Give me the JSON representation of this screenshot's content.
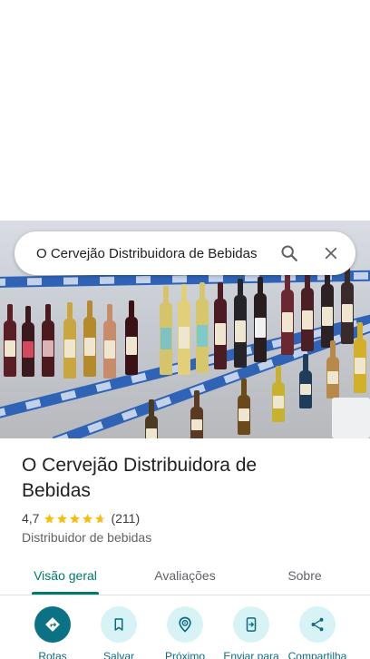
{
  "search": {
    "query": "O Cervejão Distribuidora de Bebidas"
  },
  "place": {
    "name": "O Cervejão Distribuidora de Bebidas",
    "rating": "4,7",
    "stars": 4.7,
    "review_count": "(211)",
    "category": "Distribuidor de bebidas"
  },
  "tabs": [
    "Visão geral",
    "Avaliações",
    "Sobre"
  ],
  "actions": [
    {
      "label": "Rotas",
      "icon": "directions-icon"
    },
    {
      "label": "Salvar",
      "icon": "bookmark-icon"
    },
    {
      "label": "Próximo",
      "icon": "nearby-icon"
    },
    {
      "label": "Enviar para",
      "icon": "send-to-phone-icon"
    },
    {
      "label": "Compartilha",
      "icon": "share-icon"
    }
  ],
  "colors": {
    "accent": "#00796b",
    "star": "#fbbc04",
    "action_bg": "#d7f3f5",
    "primary_action": "#0b7285"
  }
}
